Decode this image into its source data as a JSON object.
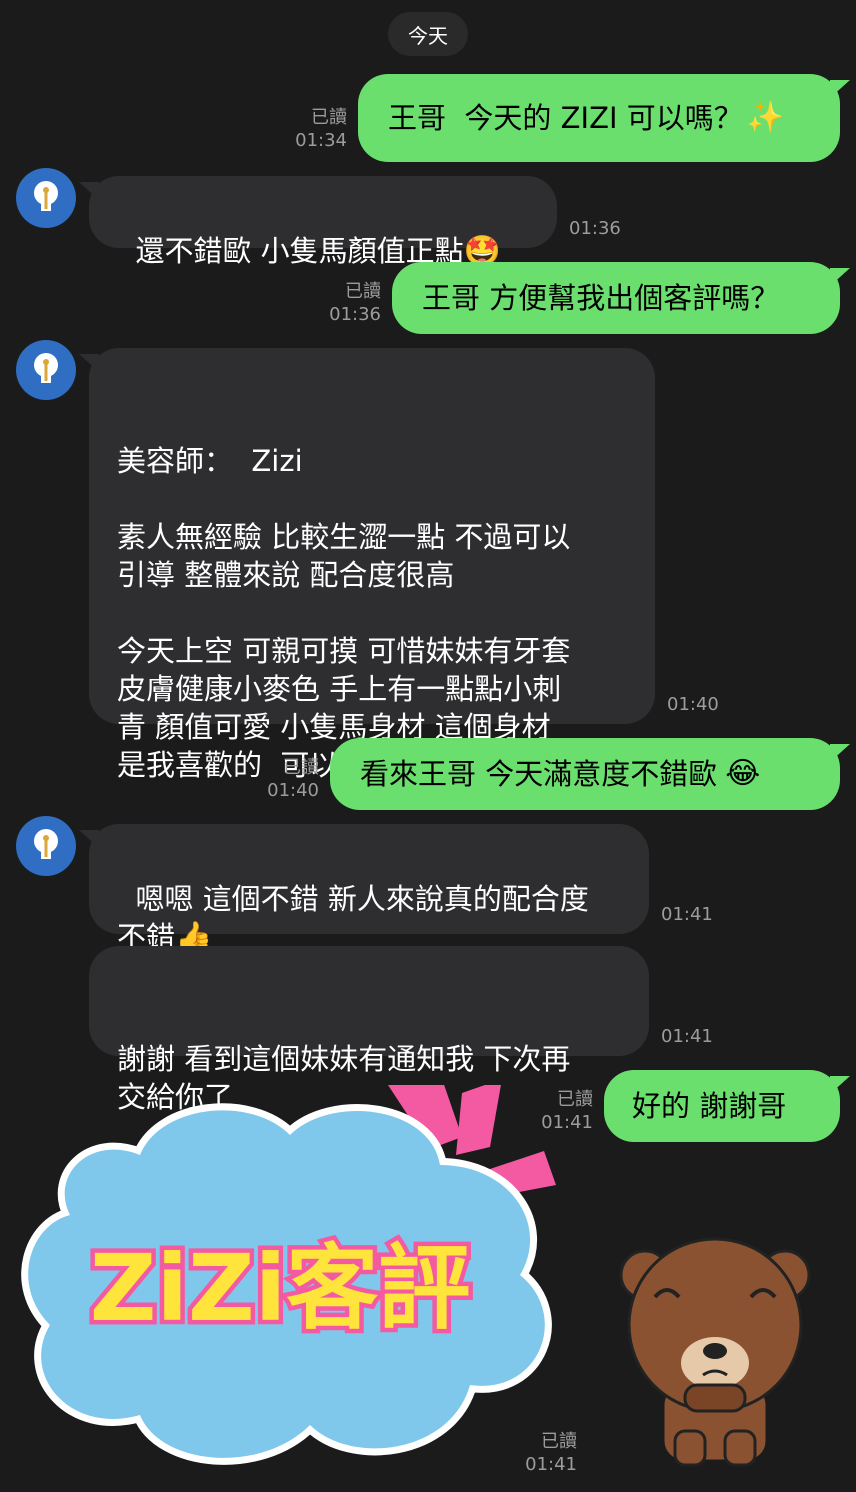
{
  "date_label": "今天",
  "read_label": "已讀",
  "messages": [
    {
      "text": "王哥  今天的 ZIZI 可以嗎？",
      "emoji": "✨",
      "time": "01:34"
    },
    {
      "text": "還不錯歐 小隻馬顏值正點",
      "emoji": "🤩",
      "time": "01:36"
    },
    {
      "text": "王哥 方便幫我出個客評嗎？",
      "time": "01:36"
    },
    {
      "text": "美容師：  Zizi\n\n素人無經驗 比較生澀一點 不過可以\n引導 整體來說 配合度很高\n\n今天上空 可親可摸 可惜妹妹有牙套\n皮膚健康小麥色 手上有一點點小刺\n青 顏值可愛 小隻馬身材 這個身材\n是我喜歡的  可以放在回沖名單內",
      "time": "01:40"
    },
    {
      "text": "看來王哥 今天滿意度不錯歐",
      "emoji": "😂",
      "time": "01:40"
    },
    {
      "text": "嗯嗯 這個不錯 新人來說真的配合度\n不錯",
      "emoji": "👍",
      "time": "01:41"
    },
    {
      "text": "謝謝 看到這個妹妹有通知我 下次再\n交給你了",
      "time": "01:41"
    },
    {
      "text": "好的 謝謝哥",
      "time": "01:41"
    }
  ],
  "sticker": {
    "text": "ZiZi客評",
    "time": "01:41"
  },
  "colors": {
    "background": "#1b1b1c",
    "outgoing": "#6bdf6e",
    "incoming": "#2e2e30",
    "avatar": "#2f6ec3"
  },
  "icons": [
    "bulb-avatar-icon",
    "sparkles-icon",
    "star-struck-emoji",
    "tears-of-joy-emoji",
    "thumbs-up-emoji"
  ]
}
